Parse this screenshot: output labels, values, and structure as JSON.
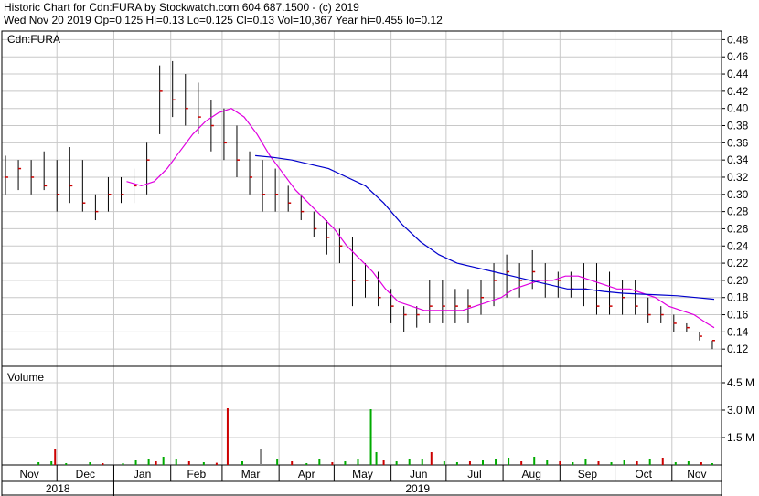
{
  "header": {
    "line1": "Historic Chart for Cdn:FURA by Stockwatch.com 604.687.1500 - (c) 2019",
    "line2": "Wed Nov 20 2019   Op=0.125  Hi=0.13  Lo=0.125  Cl=0.13  Vol=10,367  Year hi=0.455  lo=0.12"
  },
  "price_panel": {
    "label": "Cdn:FURA"
  },
  "volume_panel": {
    "label": "Volume"
  },
  "colors": {
    "grid": "#c8c8c8",
    "bar": "#000000",
    "close_tick": "#cc0000",
    "ma_short": "#e000e0",
    "ma_long": "#0000cc",
    "volume_up": "#00aa00",
    "volume_down": "#cc0000",
    "volume_neutral": "#888888"
  },
  "chart_data": [
    {
      "type": "line",
      "subtype": "ohlc_bars_with_moving_averages",
      "title": "Cdn:FURA",
      "ylim": [
        0.1,
        0.49
      ],
      "y_ticks": [
        "0.48",
        "0.46",
        "0.44",
        "0.42",
        "0.40",
        "0.38",
        "0.36",
        "0.34",
        "0.32",
        "0.30",
        "0.28",
        "0.26",
        "0.24",
        "0.22",
        "0.20",
        "0.18",
        "0.16",
        "0.14",
        "0.12"
      ],
      "x_month_labels": [
        "Nov",
        "Dec",
        "Jan",
        "Feb",
        "Mar",
        "Apr",
        "May",
        "Jun",
        "Jul",
        "Aug",
        "Sep",
        "Oct",
        "Nov"
      ],
      "x_year_labels": [
        "2018",
        "2019"
      ],
      "x_range_days": [
        0,
        392
      ],
      "month_starts_days": [
        0,
        30,
        61,
        92,
        120,
        151,
        181,
        212,
        242,
        273,
        304,
        334,
        365
      ],
      "year_start_days": [
        0,
        61
      ],
      "weekly_bars": [
        {
          "d": 2,
          "h": 0.345,
          "l": 0.3,
          "c": 0.32
        },
        {
          "d": 9,
          "h": 0.34,
          "l": 0.305,
          "c": 0.33
        },
        {
          "d": 16,
          "h": 0.34,
          "l": 0.3,
          "c": 0.32
        },
        {
          "d": 23,
          "h": 0.35,
          "l": 0.305,
          "c": 0.31
        },
        {
          "d": 30,
          "h": 0.34,
          "l": 0.28,
          "c": 0.3
        },
        {
          "d": 37,
          "h": 0.355,
          "l": 0.29,
          "c": 0.31
        },
        {
          "d": 44,
          "h": 0.34,
          "l": 0.28,
          "c": 0.29
        },
        {
          "d": 51,
          "h": 0.3,
          "l": 0.27,
          "c": 0.28
        },
        {
          "d": 58,
          "h": 0.32,
          "l": 0.28,
          "c": 0.3
        },
        {
          "d": 65,
          "h": 0.32,
          "l": 0.29,
          "c": 0.3
        },
        {
          "d": 72,
          "h": 0.33,
          "l": 0.29,
          "c": 0.31
        },
        {
          "d": 79,
          "h": 0.36,
          "l": 0.3,
          "c": 0.34
        },
        {
          "d": 86,
          "h": 0.45,
          "l": 0.37,
          "c": 0.42
        },
        {
          "d": 93,
          "h": 0.455,
          "l": 0.39,
          "c": 0.41
        },
        {
          "d": 100,
          "h": 0.44,
          "l": 0.38,
          "c": 0.4
        },
        {
          "d": 107,
          "h": 0.43,
          "l": 0.37,
          "c": 0.39
        },
        {
          "d": 114,
          "h": 0.41,
          "l": 0.35,
          "c": 0.38
        },
        {
          "d": 121,
          "h": 0.4,
          "l": 0.34,
          "c": 0.36
        },
        {
          "d": 128,
          "h": 0.38,
          "l": 0.32,
          "c": 0.34
        },
        {
          "d": 135,
          "h": 0.35,
          "l": 0.3,
          "c": 0.32
        },
        {
          "d": 142,
          "h": 0.34,
          "l": 0.28,
          "c": 0.3
        },
        {
          "d": 149,
          "h": 0.33,
          "l": 0.28,
          "c": 0.3
        },
        {
          "d": 156,
          "h": 0.31,
          "l": 0.28,
          "c": 0.29
        },
        {
          "d": 163,
          "h": 0.3,
          "l": 0.27,
          "c": 0.28
        },
        {
          "d": 170,
          "h": 0.28,
          "l": 0.25,
          "c": 0.26
        },
        {
          "d": 177,
          "h": 0.27,
          "l": 0.23,
          "c": 0.25
        },
        {
          "d": 184,
          "h": 0.26,
          "l": 0.22,
          "c": 0.24
        },
        {
          "d": 191,
          "h": 0.25,
          "l": 0.17,
          "c": 0.2
        },
        {
          "d": 198,
          "h": 0.22,
          "l": 0.18,
          "c": 0.2
        },
        {
          "d": 205,
          "h": 0.21,
          "l": 0.17,
          "c": 0.18
        },
        {
          "d": 212,
          "h": 0.19,
          "l": 0.15,
          "c": 0.17
        },
        {
          "d": 219,
          "h": 0.17,
          "l": 0.14,
          "c": 0.16
        },
        {
          "d": 226,
          "h": 0.17,
          "l": 0.145,
          "c": 0.16
        },
        {
          "d": 233,
          "h": 0.2,
          "l": 0.15,
          "c": 0.17
        },
        {
          "d": 240,
          "h": 0.2,
          "l": 0.15,
          "c": 0.17
        },
        {
          "d": 247,
          "h": 0.19,
          "l": 0.15,
          "c": 0.17
        },
        {
          "d": 254,
          "h": 0.19,
          "l": 0.15,
          "c": 0.17
        },
        {
          "d": 261,
          "h": 0.2,
          "l": 0.16,
          "c": 0.18
        },
        {
          "d": 268,
          "h": 0.22,
          "l": 0.17,
          "c": 0.2
        },
        {
          "d": 275,
          "h": 0.23,
          "l": 0.18,
          "c": 0.21
        },
        {
          "d": 282,
          "h": 0.22,
          "l": 0.18,
          "c": 0.2
        },
        {
          "d": 289,
          "h": 0.235,
          "l": 0.19,
          "c": 0.21
        },
        {
          "d": 296,
          "h": 0.22,
          "l": 0.18,
          "c": 0.2
        },
        {
          "d": 303,
          "h": 0.21,
          "l": 0.18,
          "c": 0.2
        },
        {
          "d": 310,
          "h": 0.21,
          "l": 0.18,
          "c": 0.19
        },
        {
          "d": 317,
          "h": 0.22,
          "l": 0.17,
          "c": 0.19
        },
        {
          "d": 324,
          "h": 0.22,
          "l": 0.16,
          "c": 0.17
        },
        {
          "d": 331,
          "h": 0.21,
          "l": 0.16,
          "c": 0.17
        },
        {
          "d": 338,
          "h": 0.2,
          "l": 0.16,
          "c": 0.18
        },
        {
          "d": 345,
          "h": 0.2,
          "l": 0.16,
          "c": 0.17
        },
        {
          "d": 352,
          "h": 0.18,
          "l": 0.15,
          "c": 0.16
        },
        {
          "d": 359,
          "h": 0.17,
          "l": 0.15,
          "c": 0.16
        },
        {
          "d": 366,
          "h": 0.16,
          "l": 0.14,
          "c": 0.15
        },
        {
          "d": 373,
          "h": 0.15,
          "l": 0.14,
          "c": 0.145
        },
        {
          "d": 380,
          "h": 0.14,
          "l": 0.13,
          "c": 0.135
        },
        {
          "d": 387,
          "h": 0.13,
          "l": 0.12,
          "c": 0.13
        }
      ],
      "series": [
        {
          "role": "short_moving_average",
          "color": "#e000e0",
          "x": [
            68,
            76,
            83,
            90,
            97,
            104,
            111,
            118,
            125,
            132,
            139,
            146,
            153,
            160,
            167,
            174,
            181,
            188,
            195,
            202,
            209,
            216,
            223,
            230,
            237,
            244,
            251,
            258,
            265,
            272,
            279,
            286,
            293,
            300,
            307,
            314,
            321,
            328,
            335,
            342,
            349,
            356,
            363,
            370,
            377,
            384,
            388
          ],
          "y": [
            0.315,
            0.31,
            0.315,
            0.33,
            0.35,
            0.37,
            0.385,
            0.395,
            0.4,
            0.39,
            0.37,
            0.345,
            0.325,
            0.305,
            0.29,
            0.275,
            0.26,
            0.24,
            0.225,
            0.21,
            0.19,
            0.175,
            0.17,
            0.165,
            0.165,
            0.165,
            0.165,
            0.17,
            0.175,
            0.18,
            0.19,
            0.195,
            0.2,
            0.2,
            0.205,
            0.205,
            0.2,
            0.195,
            0.19,
            0.19,
            0.185,
            0.18,
            0.17,
            0.165,
            0.16,
            0.15,
            0.145
          ]
        },
        {
          "role": "long_moving_average",
          "color": "#0000cc",
          "x": [
            138,
            148,
            158,
            168,
            178,
            188,
            198,
            208,
            218,
            228,
            238,
            248,
            258,
            268,
            278,
            288,
            298,
            308,
            318,
            328,
            338,
            348,
            358,
            368,
            378,
            388
          ],
          "y": [
            0.345,
            0.343,
            0.34,
            0.335,
            0.33,
            0.32,
            0.31,
            0.29,
            0.265,
            0.245,
            0.23,
            0.22,
            0.215,
            0.21,
            0.205,
            0.2,
            0.195,
            0.19,
            0.19,
            0.187,
            0.185,
            0.184,
            0.183,
            0.182,
            0.18,
            0.178
          ]
        }
      ]
    },
    {
      "type": "bar",
      "title": "Volume",
      "ylim": [
        0,
        5.4
      ],
      "y_ticks": [
        "4.5 M",
        "3.0 M",
        "1.5 M"
      ],
      "unit": "M",
      "bars": [
        {
          "d": 20,
          "v": 0.15,
          "k": "g"
        },
        {
          "d": 27,
          "v": 0.2,
          "k": "g"
        },
        {
          "d": 29,
          "v": 0.9,
          "k": "r"
        },
        {
          "d": 35,
          "v": 0.1,
          "k": "g"
        },
        {
          "d": 48,
          "v": 0.15,
          "k": "g"
        },
        {
          "d": 55,
          "v": 0.1,
          "k": "r"
        },
        {
          "d": 66,
          "v": 0.1,
          "k": "g"
        },
        {
          "d": 73,
          "v": 0.25,
          "k": "g"
        },
        {
          "d": 80,
          "v": 0.35,
          "k": "g"
        },
        {
          "d": 84,
          "v": 0.2,
          "k": "r"
        },
        {
          "d": 88,
          "v": 0.45,
          "k": "g"
        },
        {
          "d": 95,
          "v": 0.3,
          "k": "g"
        },
        {
          "d": 102,
          "v": 0.2,
          "k": "r"
        },
        {
          "d": 110,
          "v": 0.15,
          "k": "g"
        },
        {
          "d": 117,
          "v": 0.12,
          "k": "r"
        },
        {
          "d": 123,
          "v": 3.1,
          "k": "r"
        },
        {
          "d": 131,
          "v": 0.2,
          "k": "g"
        },
        {
          "d": 141,
          "v": 0.9,
          "k": "n"
        },
        {
          "d": 150,
          "v": 0.3,
          "k": "g"
        },
        {
          "d": 158,
          "v": 0.2,
          "k": "r"
        },
        {
          "d": 166,
          "v": 0.1,
          "k": "g"
        },
        {
          "d": 173,
          "v": 0.3,
          "k": "g"
        },
        {
          "d": 180,
          "v": 0.15,
          "k": "r"
        },
        {
          "d": 187,
          "v": 0.2,
          "k": "g"
        },
        {
          "d": 194,
          "v": 0.35,
          "k": "g"
        },
        {
          "d": 201,
          "v": 3.05,
          "k": "g"
        },
        {
          "d": 204,
          "v": 0.7,
          "k": "g"
        },
        {
          "d": 208,
          "v": 0.25,
          "k": "r"
        },
        {
          "d": 215,
          "v": 0.2,
          "k": "g"
        },
        {
          "d": 222,
          "v": 0.3,
          "k": "g"
        },
        {
          "d": 229,
          "v": 0.35,
          "k": "g"
        },
        {
          "d": 234,
          "v": 0.7,
          "k": "r"
        },
        {
          "d": 241,
          "v": 0.2,
          "k": "g"
        },
        {
          "d": 248,
          "v": 0.15,
          "k": "g"
        },
        {
          "d": 255,
          "v": 0.2,
          "k": "r"
        },
        {
          "d": 262,
          "v": 0.25,
          "k": "g"
        },
        {
          "d": 269,
          "v": 0.3,
          "k": "g"
        },
        {
          "d": 276,
          "v": 0.4,
          "k": "g"
        },
        {
          "d": 283,
          "v": 0.2,
          "k": "r"
        },
        {
          "d": 290,
          "v": 0.45,
          "k": "g"
        },
        {
          "d": 297,
          "v": 0.25,
          "k": "g"
        },
        {
          "d": 304,
          "v": 0.2,
          "k": "r"
        },
        {
          "d": 311,
          "v": 0.15,
          "k": "g"
        },
        {
          "d": 318,
          "v": 0.3,
          "k": "g"
        },
        {
          "d": 325,
          "v": 0.2,
          "k": "r"
        },
        {
          "d": 332,
          "v": 0.15,
          "k": "g"
        },
        {
          "d": 339,
          "v": 0.25,
          "k": "g"
        },
        {
          "d": 346,
          "v": 0.2,
          "k": "r"
        },
        {
          "d": 353,
          "v": 0.35,
          "k": "g"
        },
        {
          "d": 360,
          "v": 0.4,
          "k": "r"
        },
        {
          "d": 367,
          "v": 0.15,
          "k": "g"
        },
        {
          "d": 374,
          "v": 0.2,
          "k": "g"
        },
        {
          "d": 381,
          "v": 0.15,
          "k": "r"
        },
        {
          "d": 387,
          "v": 0.1,
          "k": "g"
        }
      ]
    }
  ]
}
